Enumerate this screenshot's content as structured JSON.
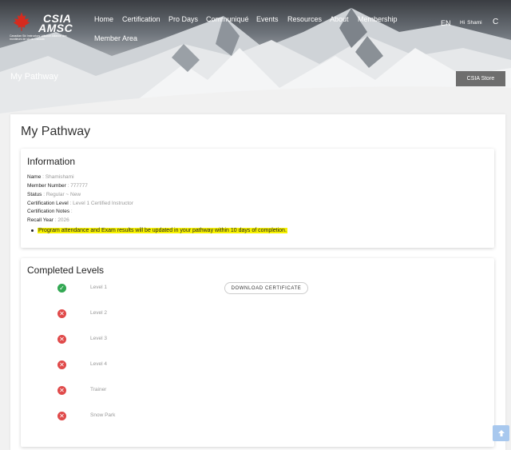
{
  "logo": {
    "line1": "CSIA",
    "line2": "AMSC",
    "tagline": "Canadian Ski Instructors' Alliance Alliance des moniteurs de ski du Canada"
  },
  "nav": {
    "items": [
      "Home",
      "Certification",
      "Pro Days",
      "Communiqué",
      "Events",
      "Resources",
      "About",
      "Membership",
      "Member Area"
    ]
  },
  "header": {
    "language": "EN",
    "greeting": "Hi",
    "user_name": "Shami",
    "user_initial": "C"
  },
  "hero": {
    "title": "My Pathway",
    "store_button": "CSIA Store"
  },
  "page": {
    "title": "My Pathway"
  },
  "information": {
    "heading": "Information",
    "rows": [
      {
        "label": "Name",
        "value": "Shamishami"
      },
      {
        "label": "Member Number",
        "value": "777777"
      },
      {
        "label": "Status",
        "value": "Regular ~ New"
      },
      {
        "label": "Certification Level",
        "value": "Level 1 Certified Instructor"
      },
      {
        "label": "Certification Notes",
        "value": ""
      },
      {
        "label": "Recall Year",
        "value": "2026"
      }
    ],
    "note": "Program attendance and Exam results will be updated in your pathway within 10 days of completion."
  },
  "completed_levels": {
    "heading": "Completed Levels",
    "download_label": "DOWNLOAD CERTIFICATE",
    "levels": [
      {
        "name": "Level 1",
        "completed": true
      },
      {
        "name": "Level 2",
        "completed": false
      },
      {
        "name": "Level 3",
        "completed": false
      },
      {
        "name": "Level 4",
        "completed": false
      },
      {
        "name": "Trainer",
        "completed": false
      },
      {
        "name": "Snow Park",
        "completed": false
      }
    ]
  },
  "colors": {
    "success": "#33a853",
    "error": "#e04a4a",
    "highlight": "#f7f200",
    "scroll_button": "#a8c8ee"
  }
}
